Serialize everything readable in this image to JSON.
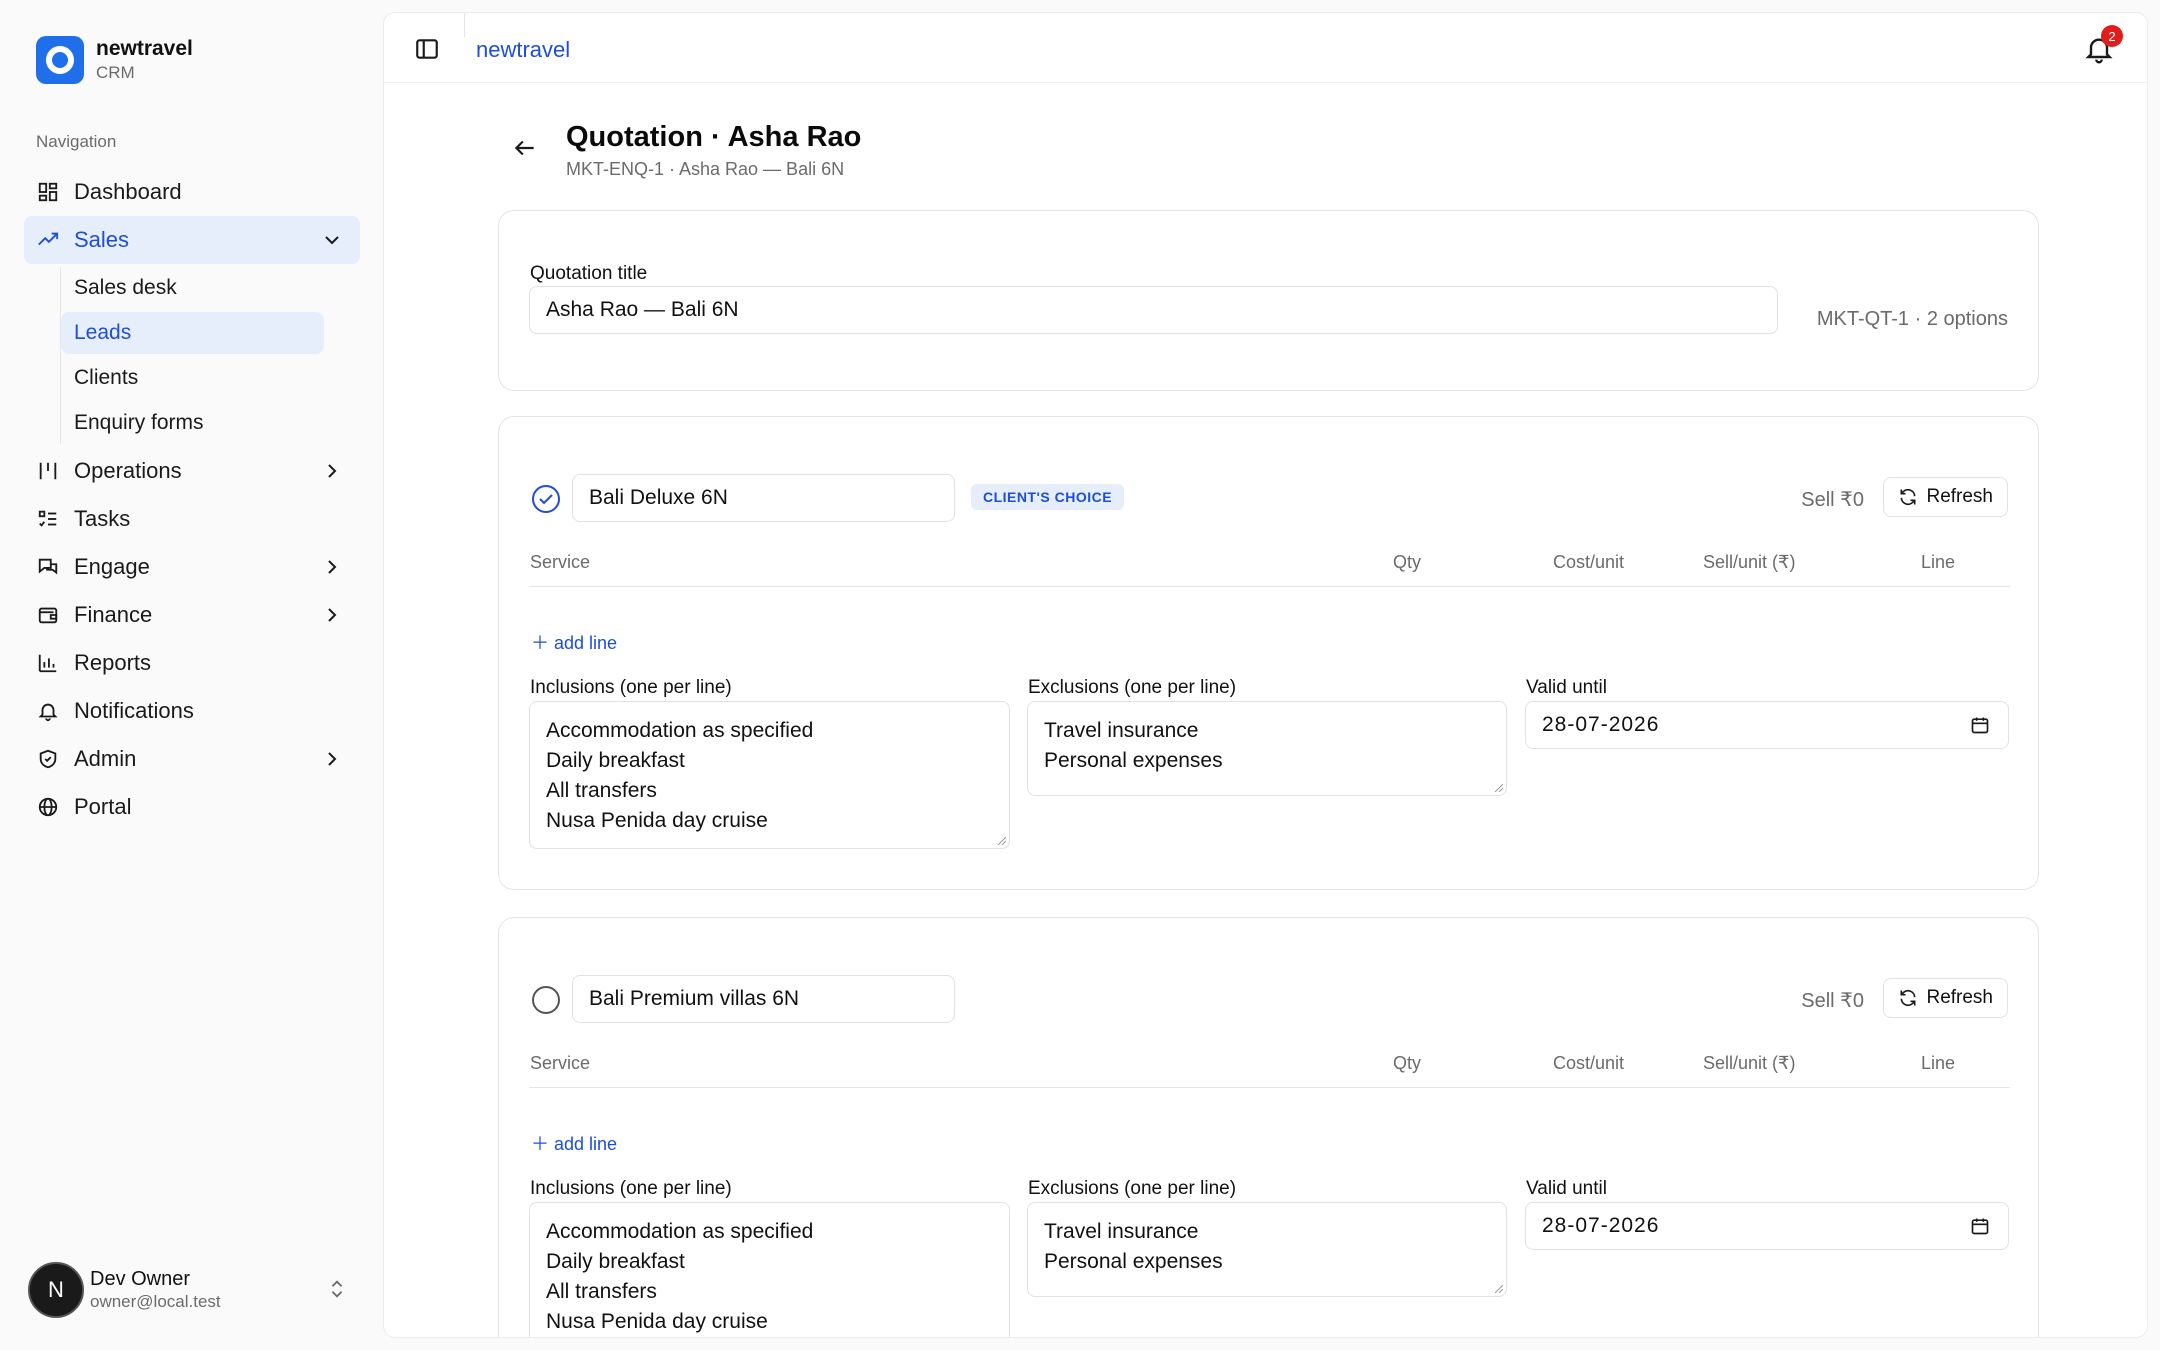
{
  "app": {
    "name": "newtravel",
    "sub": "CRM"
  },
  "nav": {
    "heading": "Navigation",
    "items": {
      "dashboard": "Dashboard",
      "sales": "Sales",
      "operations": "Operations",
      "tasks": "Tasks",
      "engage": "Engage",
      "finance": "Finance",
      "reports": "Reports",
      "notifications": "Notifications",
      "admin": "Admin",
      "portal": "Portal"
    },
    "sales_sub": {
      "sales_desk": "Sales desk",
      "leads": "Leads",
      "clients": "Clients",
      "enquiry_forms": "Enquiry forms"
    }
  },
  "user": {
    "initial": "N",
    "name": "Dev Owner",
    "email": "owner@local.test"
  },
  "topbar": {
    "breadcrumb": "newtravel",
    "notification_count": "2"
  },
  "page": {
    "title": "Quotation · Asha Rao",
    "subtitle": "MKT-ENQ-1 · Asha Rao — Bali 6N"
  },
  "quotation": {
    "title_label": "Quotation title",
    "title_value": "Asha Rao — Bali 6N",
    "meta": "MKT-QT-1 · 2 options"
  },
  "table_headers": {
    "service": "Service",
    "qty": "Qty",
    "cost": "Cost/unit",
    "sell": "Sell/unit (₹)",
    "line": "Line"
  },
  "options": [
    {
      "name": "Bali Deluxe 6N",
      "badge": "CLIENT'S CHOICE",
      "selected": true,
      "sell": "Sell ₹0",
      "refresh": "Refresh",
      "add_line": "add line",
      "inclusions_label": "Inclusions (one per line)",
      "inclusions": [
        "Accommodation as specified",
        "Daily breakfast",
        "All transfers",
        "Nusa Penida day cruise"
      ],
      "exclusions_label": "Exclusions (one per line)",
      "exclusions": [
        "Travel insurance",
        "Personal expenses"
      ],
      "valid_label": "Valid until",
      "valid_until": "28-07-2026"
    },
    {
      "name": "Bali Premium villas 6N",
      "badge": "",
      "selected": false,
      "sell": "Sell ₹0",
      "refresh": "Refresh",
      "add_line": "add line",
      "inclusions_label": "Inclusions (one per line)",
      "inclusions": [
        "Accommodation as specified",
        "Daily breakfast",
        "All transfers",
        "Nusa Penida day cruise"
      ],
      "exclusions_label": "Exclusions (one per line)",
      "exclusions": [
        "Travel insurance",
        "Personal expenses"
      ],
      "valid_label": "Valid until",
      "valid_until": "28-07-2026"
    }
  ],
  "colors": {
    "accent": "#1d4ed8",
    "brand": "#1f6feb",
    "badge_bg": "#e6eefc",
    "alert": "#e11d1d"
  }
}
